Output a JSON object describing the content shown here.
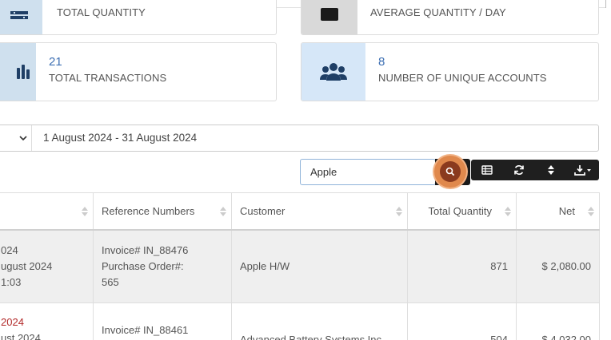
{
  "cards": [
    {
      "value": "",
      "label": "TOTAL QUANTITY",
      "icon": "tray-icon"
    },
    {
      "value": "",
      "label": "AVERAGE QUANTITY / DAY",
      "icon": "calendar-icon"
    },
    {
      "value": "21",
      "label": "TOTAL TRANSACTIONS",
      "icon": "bar-chart-icon"
    },
    {
      "value": "8",
      "label": "NUMBER OF UNIQUE ACCOUNTS",
      "icon": "users-icon"
    }
  ],
  "filter": {
    "date_range": "1 August 2024 - 31 August 2024"
  },
  "search": {
    "value": "Apple",
    "icon": "search-icon"
  },
  "toolbar": {
    "icons": [
      "table-icon",
      "refresh-icon",
      "sort-icon",
      "download-icon"
    ]
  },
  "colors": {
    "accent": "#3d6fb3",
    "search_highlight": "#e0894d",
    "toolbar": "#1f1f1f",
    "date_red": "#b22a2a"
  },
  "table": {
    "headers": [
      "",
      "Reference Numbers",
      "Customer",
      "Total Quantity",
      "Net"
    ],
    "rows": [
      {
        "date": [
          "024",
          "ugust 2024",
          "1:03"
        ],
        "refs": [
          "Invoice# IN_88476",
          "Purchase Order#:",
          "565"
        ],
        "customer": "Apple H/W",
        "quantity": "871",
        "net": "$ 2,080.00"
      },
      {
        "date": [
          "2024",
          "ust 2024"
        ],
        "refs": [
          "Invoice# IN_88461"
        ],
        "customer": "Advanced Battery Systems Inc",
        "quantity": "504",
        "net": "$ 4,032.00"
      }
    ]
  }
}
